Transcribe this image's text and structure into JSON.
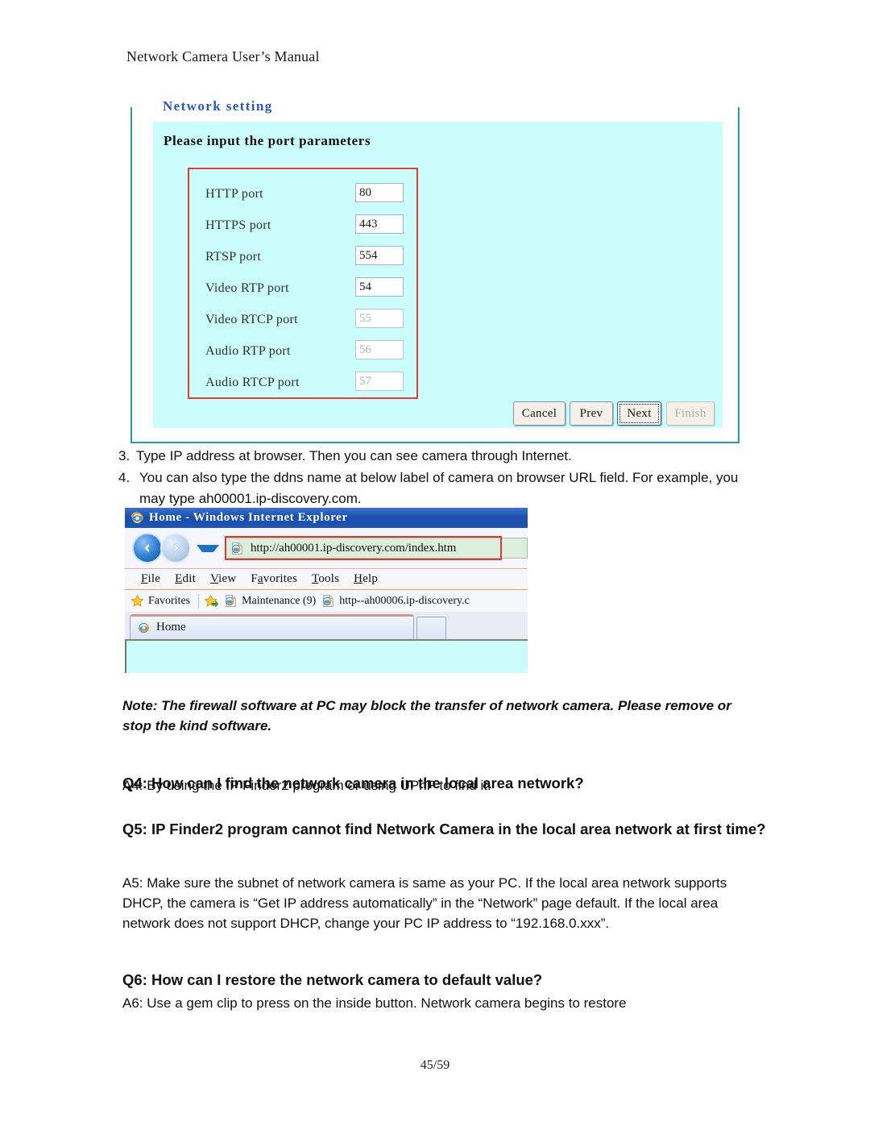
{
  "page": {
    "running_header": "Network Camera User’s Manual",
    "footer": "45/59"
  },
  "network_setting_dialog": {
    "legend": "Network setting",
    "heading": "Please input the port parameters",
    "ports": [
      {
        "label": "HTTP port",
        "value": "80",
        "disabled": false
      },
      {
        "label": "HTTPS port",
        "value": "443",
        "disabled": false
      },
      {
        "label": "RTSP port",
        "value": "554",
        "disabled": false
      },
      {
        "label": "Video RTP port",
        "value": "54",
        "disabled": false
      },
      {
        "label": "Video RTCP port",
        "value": "55",
        "disabled": true
      },
      {
        "label": "Audio RTP port",
        "value": "56",
        "disabled": true
      },
      {
        "label": "Audio RTCP port",
        "value": "57",
        "disabled": true
      }
    ],
    "buttons": {
      "cancel": "Cancel",
      "prev": "Prev",
      "next": "Next",
      "finish": "Finish"
    },
    "colors": {
      "panel_background": "#ccfdfd",
      "frame_border": "#2b9aa6",
      "legend_text": "#2a56c6",
      "highlight_box": "#ec3a30"
    }
  },
  "steps": [
    {
      "num": "3.",
      "text": "Type IP address at browser. Then you can see camera through Internet."
    },
    {
      "num": "4.",
      "text": "You can also type the ddns name at below label of camera on browser URL field. For example, you may type ah00001.ip-discovery.com."
    }
  ],
  "ie_window": {
    "title": "Home - Windows Internet Explorer",
    "address_value": "http://ah00001.ip-discovery.com/index.htm",
    "menu": [
      "File",
      "Edit",
      "View",
      "Favorites",
      "Tools",
      "Help"
    ],
    "menu_mnemonics": [
      "F",
      "E",
      "V",
      "a",
      "T",
      "H"
    ],
    "favorites_bar": {
      "favorites_label": "Favorites",
      "items": [
        "Maintenance (9)",
        "http--ah00006.ip-discovery.c"
      ]
    },
    "tab_label": "Home",
    "colors": {
      "titlebar": "#1b52b4",
      "address_background": "#dceedc",
      "address_highlight": "#e8372c",
      "content_background": "#ccfdfd"
    }
  },
  "note": "Note: The firewall software at PC may block the transfer of network camera. Please remove or stop the kind software.",
  "faq": [
    {
      "q": "Q4: How can I find the network camera in the local area network?",
      "a": "A4: By using the IP Finder2 program or using UPnP to find it."
    },
    {
      "q": "Q5: IP Finder2 program cannot find Network Camera in the local area network at first time?",
      "a": "A5: Make sure the subnet of network camera is same as your PC. If the local area network supports DHCP, the camera is “Get IP address automatically” in the “Network” page default. If the local area network does not support DHCP, change your PC IP address to “192.168.0.xxx”."
    },
    {
      "q": "Q6: How can I restore the network camera to default value?",
      "a": "A6: Use a gem clip to press on the inside button. Network camera begins to restore"
    }
  ]
}
